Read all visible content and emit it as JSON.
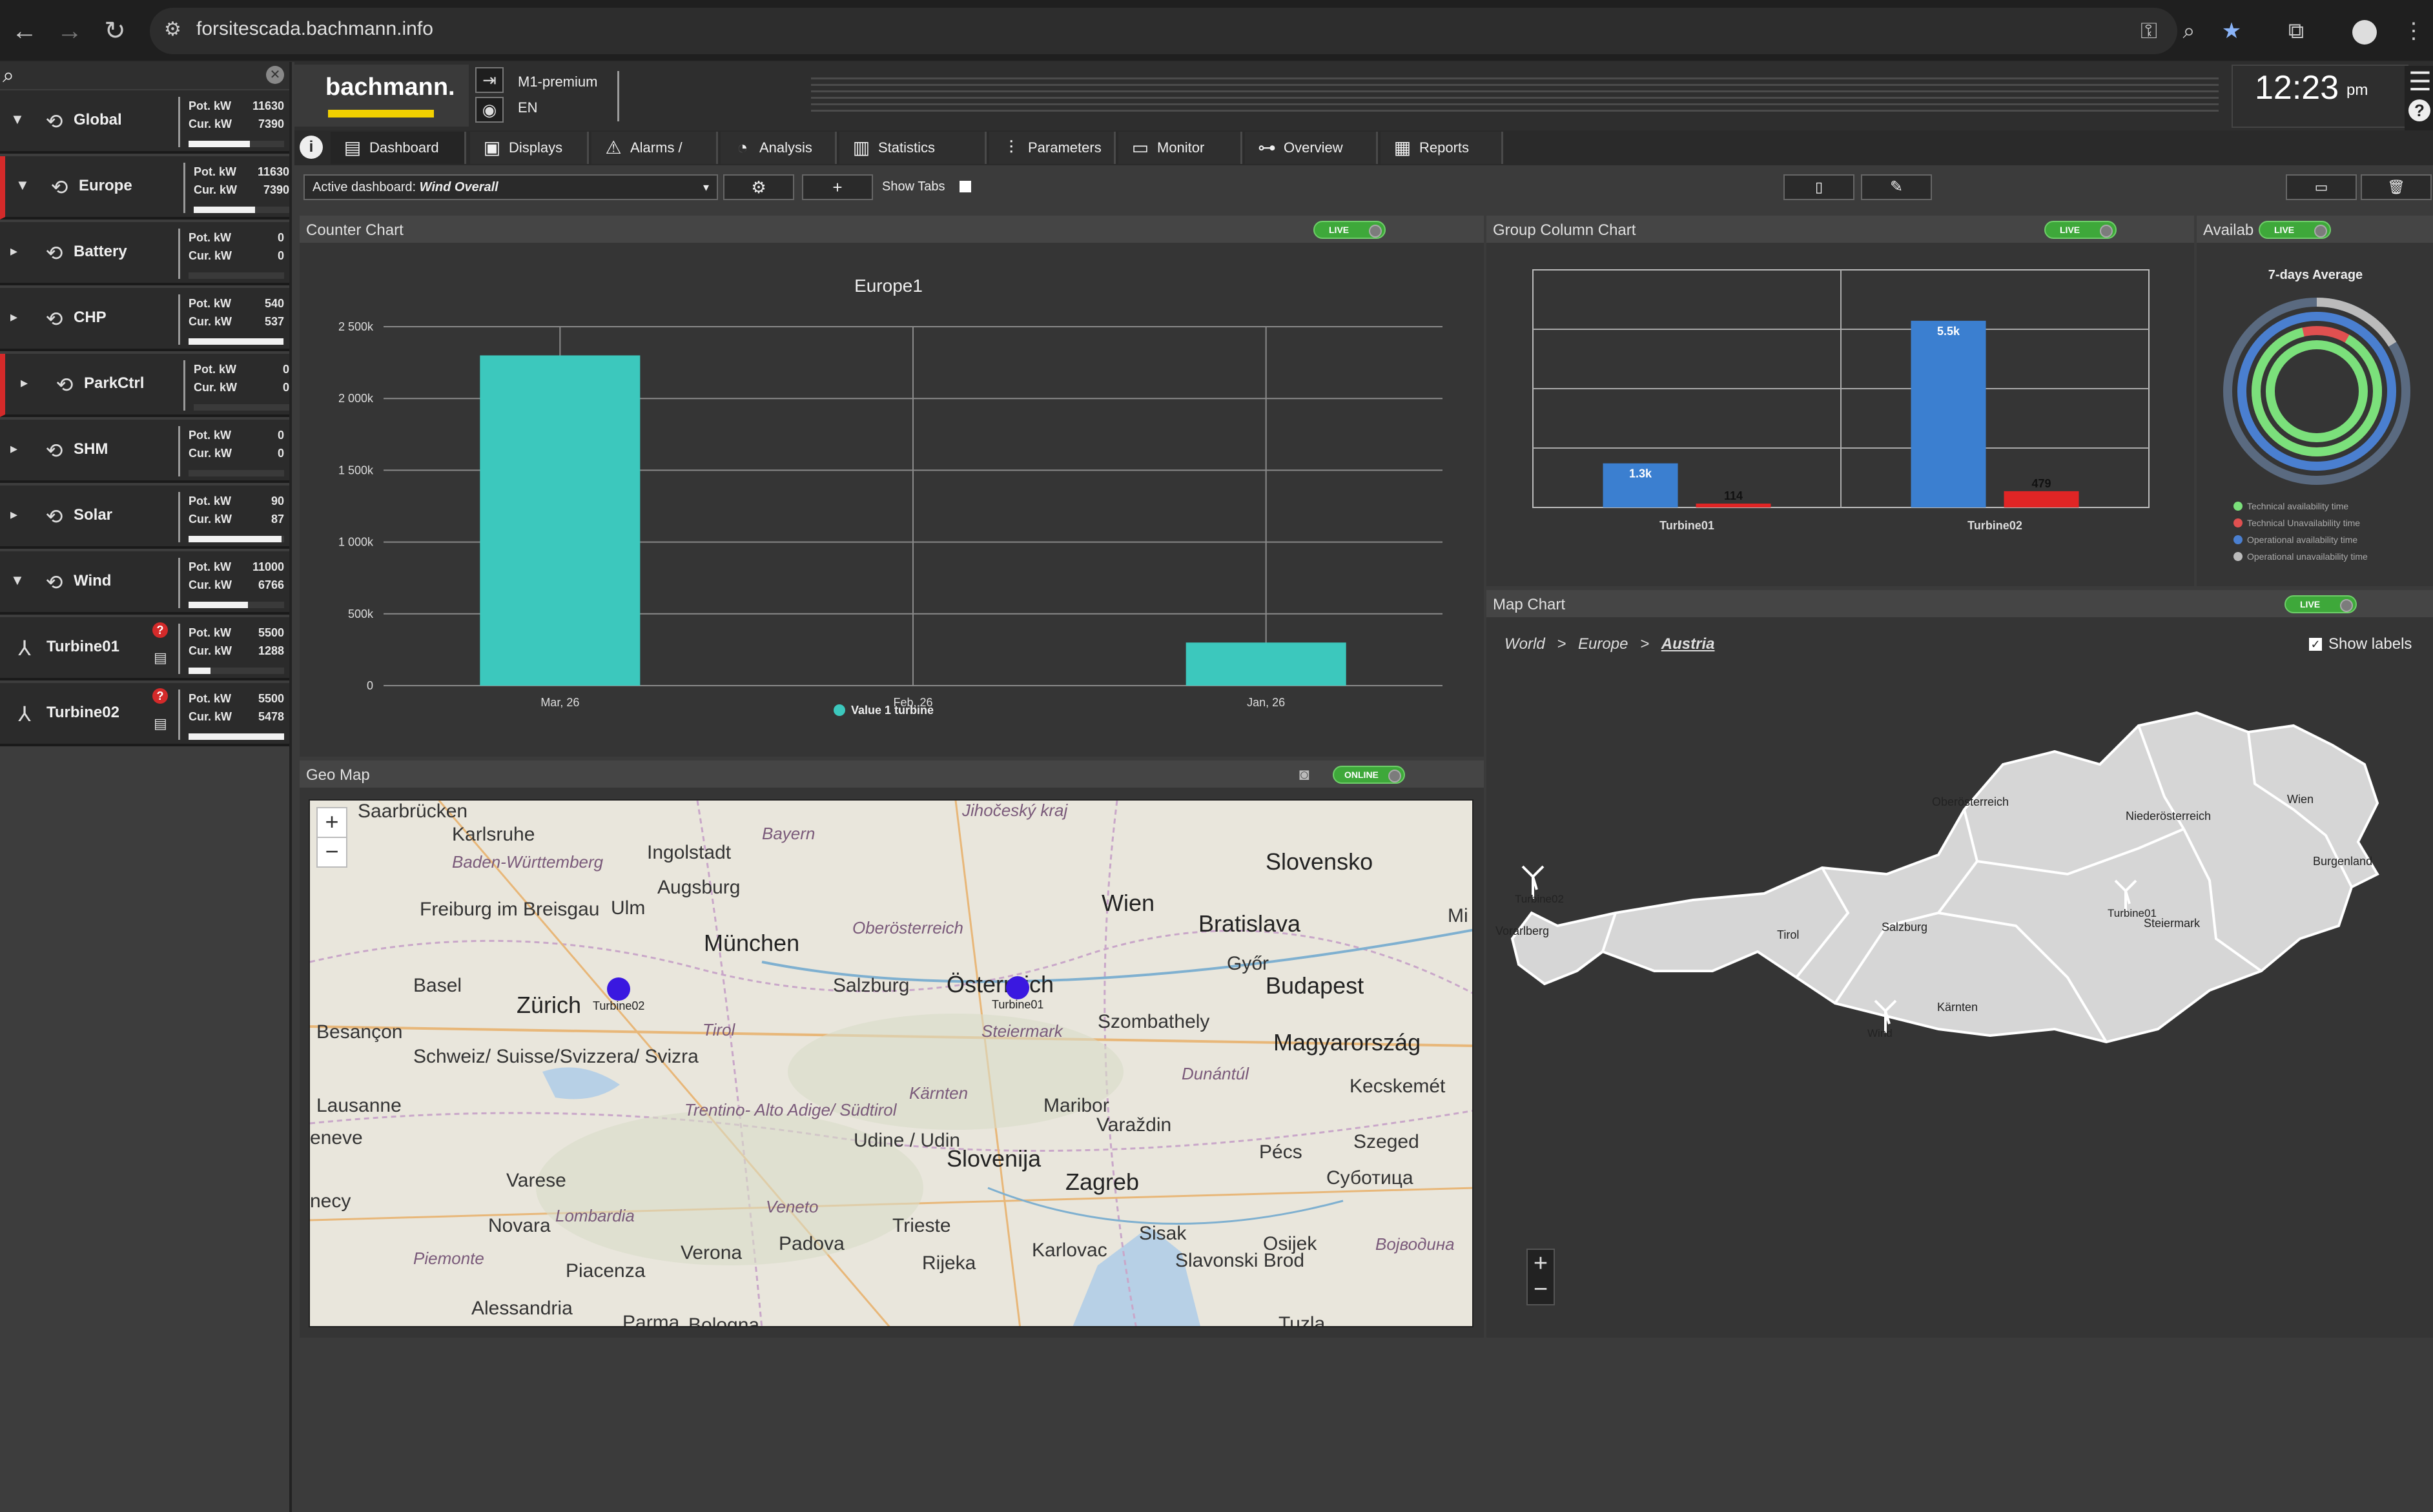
{
  "browser": {
    "url": "forsitescada.bachmann.info"
  },
  "sidebar": {
    "nodes": [
      {
        "label": "Global",
        "pot_label": "Pot. kW",
        "pot": "11630",
        "cur_label": "Cur. kW",
        "cur": "7390",
        "fill": 0.64,
        "alarm": false,
        "arrow": "▼"
      },
      {
        "label": "Europe",
        "pot_label": "Pot. kW",
        "pot": "11630",
        "cur_label": "Cur. kW",
        "cur": "7390",
        "fill": 0.64,
        "alarm": true,
        "arrow": "▼"
      },
      {
        "label": "Battery",
        "pot_label": "Pot. kW",
        "pot": "0",
        "cur_label": "Cur. kW",
        "cur": "0",
        "fill": 0.0,
        "alarm": false,
        "arrow": "▸"
      },
      {
        "label": "CHP",
        "pot_label": "Pot. kW",
        "pot": "540",
        "cur_label": "Cur. kW",
        "cur": "537",
        "fill": 0.99,
        "alarm": false,
        "arrow": "▸"
      },
      {
        "label": "ParkCtrl",
        "pot_label": "Pot. kW",
        "pot": "0",
        "cur_label": "Cur. kW",
        "cur": "0",
        "fill": 0.0,
        "alarm": true,
        "arrow": "▸"
      },
      {
        "label": "SHM",
        "pot_label": "Pot. kW",
        "pot": "0",
        "cur_label": "Cur. kW",
        "cur": "0",
        "fill": 0.0,
        "alarm": false,
        "arrow": "▸"
      },
      {
        "label": "Solar",
        "pot_label": "Pot. kW",
        "pot": "90",
        "cur_label": "Cur. kW",
        "cur": "87",
        "fill": 0.97,
        "alarm": false,
        "arrow": "▸"
      },
      {
        "label": "Wind",
        "pot_label": "Pot. kW",
        "pot": "11000",
        "cur_label": "Cur. kW",
        "cur": "6766",
        "fill": 0.62,
        "alarm": false,
        "arrow": "▼"
      },
      {
        "label": "Turbine01",
        "pot_label": "Pot. kW",
        "pot": "5500",
        "cur_label": "Cur. kW",
        "cur": "1288",
        "fill": 0.23,
        "alarm": false,
        "arrow": ""
      },
      {
        "label": "Turbine02",
        "pot_label": "Pot. kW",
        "pot": "5500",
        "cur_label": "Cur. kW",
        "cur": "5478",
        "fill": 1.0,
        "alarm": false,
        "arrow": ""
      }
    ]
  },
  "header": {
    "logo": "bachmann.",
    "product": "M1-premium",
    "lang": "EN",
    "time": "12:23",
    "ampm": "pm"
  },
  "nav": {
    "tabs": [
      {
        "label": "Dashboard",
        "icon": "dashboard-icon"
      },
      {
        "label": "Displays",
        "icon": "displays-icon"
      },
      {
        "label": "Alarms / Logs",
        "icon": "alarms-icon"
      },
      {
        "label": "Analysis",
        "icon": "analysis-icon"
      },
      {
        "label": "Statistics",
        "icon": "statistics-icon"
      },
      {
        "label": "Parameters",
        "icon": "parameters-icon"
      },
      {
        "label": "Monitor",
        "icon": "monitor-icon"
      },
      {
        "label": "Overview",
        "icon": "overview-icon"
      },
      {
        "label": "Reports",
        "icon": "reports-icon"
      }
    ]
  },
  "toolbar": {
    "dashboard_prefix": "Active dashboard:",
    "dashboard_value": "Wind Overall",
    "show_tabs": "Show Tabs"
  },
  "panels": {
    "counter_title": "Counter Chart",
    "group_title": "Group Column Chart",
    "avail_title": "Availab",
    "map_title": "Map Chart",
    "geo_title": "Geo Map",
    "live": "LIVE",
    "online": "ONLINE"
  },
  "chart_data": [
    {
      "type": "bar",
      "title": "Europe1",
      "categories": [
        "Mar, 26",
        "Feb, 26",
        "Jan, 26"
      ],
      "series": [
        {
          "name": "Value 1 turbine",
          "values": [
            2300000,
            0,
            300000
          ],
          "color": "#3cc8bd"
        }
      ],
      "yticks": [
        "0",
        "500k",
        "1 000k",
        "1 500k",
        "2 000k",
        "2 500k"
      ],
      "ylim": [
        0,
        2500000
      ],
      "legend": "bottom"
    },
    {
      "type": "bar",
      "title": "",
      "categories": [
        "Turbine01",
        "Turbine02"
      ],
      "series": [
        {
          "values": [
            1300,
            5500
          ],
          "labels": [
            "1.3k",
            "5.5k"
          ],
          "color": "#3b7fd0"
        },
        {
          "values": [
            114,
            479
          ],
          "labels": [
            "114",
            "479"
          ],
          "color": "#e02525"
        }
      ],
      "ylim": [
        0,
        7000
      ]
    },
    {
      "type": "pie",
      "title": "7-days Average",
      "legend": [
        "Technical availability time",
        "Technical Unavailability time",
        "Operational availability time",
        "Operational unavailability time"
      ],
      "colors": [
        "#7be07b",
        "#e05050",
        "#4a7fd0",
        "#bbbbbb"
      ]
    }
  ],
  "map_chart": {
    "breadcrumb": [
      "World",
      "Europe",
      "Austria"
    ],
    "separator": ">",
    "show_labels": "Show labels",
    "regions": [
      "Oberösterreich",
      "Niederösterreich",
      "Wien",
      "Burgenland",
      "Salzburg",
      "Steiermark",
      "Tirol",
      "Vorarlberg",
      "Kärnten"
    ],
    "markers": [
      "Turbine02",
      "Turbine01",
      "Wind"
    ]
  },
  "geo_map": {
    "labels": [
      "Saarbrücken",
      "Karlsruhe",
      "Bayern",
      "Jihočeský kraj",
      "Slovensko",
      "Baden-Württemberg",
      "Ingolstadt",
      "Augsburg",
      "Wien",
      "Bratislava",
      "Freiburg im Breisgau",
      "Ulm",
      "München",
      "Oberösterreich",
      "Győr",
      "Basel",
      "Zürich",
      "Salzburg",
      "Österreich",
      "Budapest",
      "Besançon",
      "Tirol",
      "Szombathely",
      "Steiermark",
      "Magyarország",
      "Schweiz/ Suisse/Svizzera/ Svizra",
      "Dunántúl",
      "Kecskemét",
      "Lausanne",
      "Trentino- Alto Adige/ Südtirol",
      "Kärnten",
      "Maribor",
      "Udine / Udin",
      "Varaždin",
      "Szeged",
      "Slovenija",
      "Zagreb",
      "Pécs",
      "Суботица",
      "Varese",
      "Veneto",
      "Lombardia",
      "Novara",
      "Trieste",
      "Padova",
      "Sisak",
      "Osijek",
      "Војводина",
      "Verona",
      "Karlovac",
      "Piemonte",
      "Piacenza",
      "Rijeka",
      "Slavonski Brod",
      "Alessandria",
      "Parma",
      "Bologna",
      "Tuzla",
      "eneve",
      "necy",
      "Mi"
    ],
    "markers": [
      "Turbine02",
      "Turbine01"
    ]
  }
}
